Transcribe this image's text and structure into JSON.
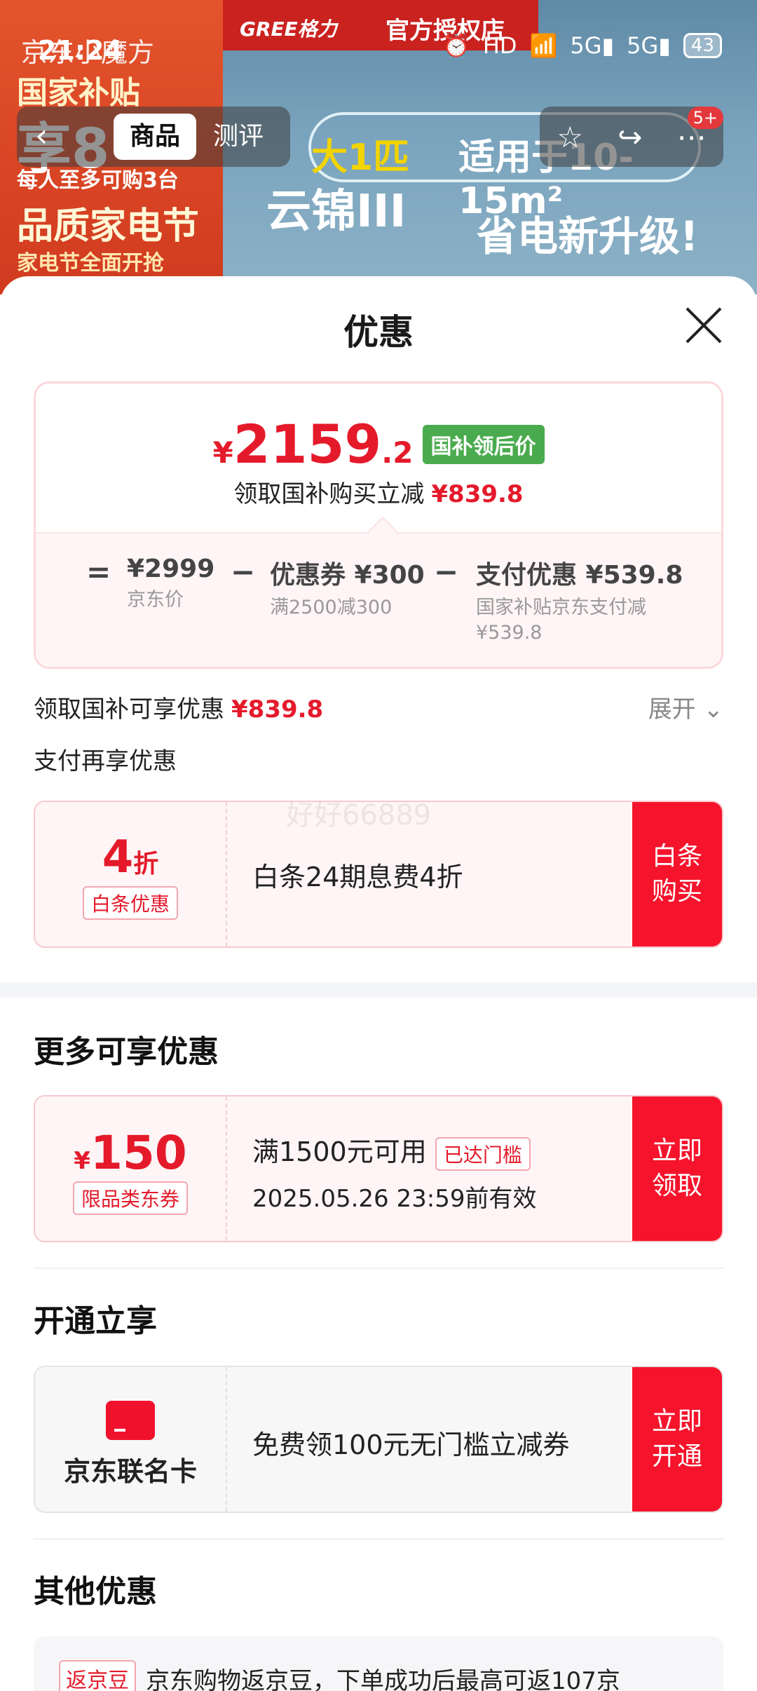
{
  "status_bar": {
    "time": "21:24",
    "app_label": "京东小魔方",
    "icons": [
      "alarm-icon",
      "hd-icon",
      "wifi-icon",
      "5g-signal-icon",
      "5g-signal-icon"
    ],
    "battery": "43"
  },
  "banner": {
    "brand": "GREE格力",
    "store": "官方授权店",
    "left_lines": [
      "国家补贴",
      "享8",
      "每人至多可购3台",
      "品质家电节",
      "家电节全面开抢"
    ],
    "slogan_1": "大1匹",
    "slogan_2": "适用于10-15m²",
    "product": "云锦III",
    "promo": "省电新升级!"
  },
  "nav": {
    "back_icon": "back-icon",
    "tab_active": "商品",
    "tab_other": "测评",
    "badge": "5+"
  },
  "sheet": {
    "title": "优惠",
    "price": {
      "symbol": "¥",
      "int": "2159",
      "dec": ".2",
      "tag": "国补领后价",
      "sub_label": "领取国补购买立减",
      "sub_amount": "¥839.8"
    },
    "formula": {
      "eq": "=",
      "minus": "−",
      "jd_price": "¥2999",
      "jd_label": "京东价",
      "coupon_val": "优惠券 ¥300",
      "coupon_desc": "满2500减300",
      "pay_val": "支付优惠 ¥539.8",
      "pay_desc_1": "国家补贴京东支付减",
      "pay_desc_2": "¥539.8"
    },
    "subsidy_row": {
      "label": "领取国补可享优惠",
      "amount": "¥839.8",
      "expand": "展开"
    },
    "pay_more": "支付再享优惠",
    "watermark": "好好66889",
    "baitiao": {
      "discount": "4",
      "discount_unit": "折",
      "tag": "白条优惠",
      "text": "白条24期息费4折",
      "button_1": "白条",
      "button_2": "购买"
    },
    "more_title": "更多可享优惠",
    "coupon": {
      "symbol": "¥",
      "amount": "150",
      "tag": "限品类东券",
      "condition": "满1500元可用",
      "reached": "已达门槛",
      "expiry": "2025.05.26 23:59前有效",
      "button_1": "立即",
      "button_2": "领取"
    },
    "open_title": "开通立享",
    "card": {
      "label": "京东联名卡",
      "text": "免费领100元无门槛立减券",
      "button_1": "立即",
      "button_2": "开通"
    },
    "other_title": "其他优惠",
    "other": {
      "tag": "返京豆",
      "text": "京东购物返京豆，下单成功后最高可返107京"
    }
  },
  "colors": {
    "accent_red": "#e41a2b",
    "button_red": "#f5142c",
    "tag_green": "#4aab4e"
  }
}
